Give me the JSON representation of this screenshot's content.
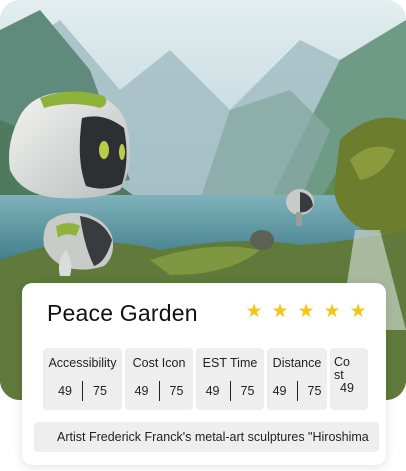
{
  "place": {
    "title": "Peace Garden",
    "rating": 5,
    "stars": [
      "★",
      "★",
      "★",
      "★",
      "★"
    ]
  },
  "stats": [
    {
      "label": "Accessibility",
      "value_a": "49",
      "value_b": "75"
    },
    {
      "label": "Cost Icon",
      "value_a": "49",
      "value_b": "75"
    },
    {
      "label": "EST Time",
      "value_a": "49",
      "value_b": "75"
    },
    {
      "label": "Distance",
      "value_a": "49",
      "value_b": "75"
    },
    {
      "label": "Cost",
      "value_a": "49"
    }
  ],
  "description": "Artist Frederick Franck's metal-art sculptures \"Hiroshima",
  "colors": {
    "star": "#f5c518",
    "robot_accent": "#8fb23a",
    "card_bg": "#ffffff",
    "chip_bg": "#eeeeee"
  }
}
